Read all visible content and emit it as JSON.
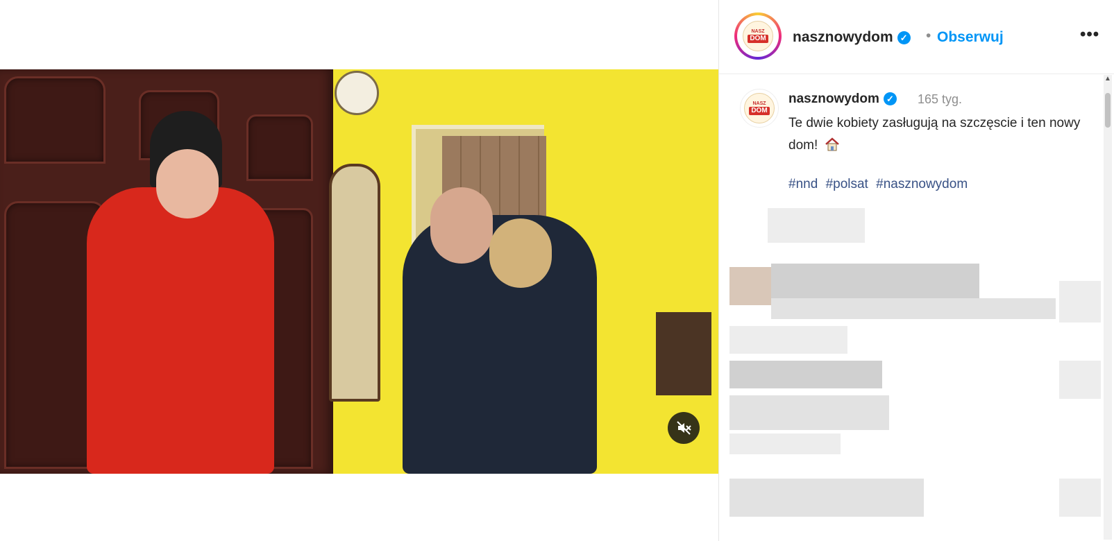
{
  "post": {
    "account_name": "nasznowydom",
    "follow_label": "Obserwuj",
    "separator": "•",
    "more_label": "•••",
    "verified_symbol": "✓",
    "logo_top": "NASZ",
    "logo_bottom": "DOM"
  },
  "caption": {
    "username": "nasznowydom",
    "time": "165 tyg.",
    "text": "Te dwie kobiety zasługują na szczęscie i ten nowy dom!",
    "emoji": "house-icon",
    "hashtags": [
      "#nnd",
      "#polsat",
      "#nasznowydom"
    ]
  },
  "video": {
    "muted": true,
    "mute_icon": "speaker-muted-icon"
  },
  "colors": {
    "accent": "#0095f6",
    "hashtag": "#385185",
    "muted_text": "#8e8e8e"
  }
}
